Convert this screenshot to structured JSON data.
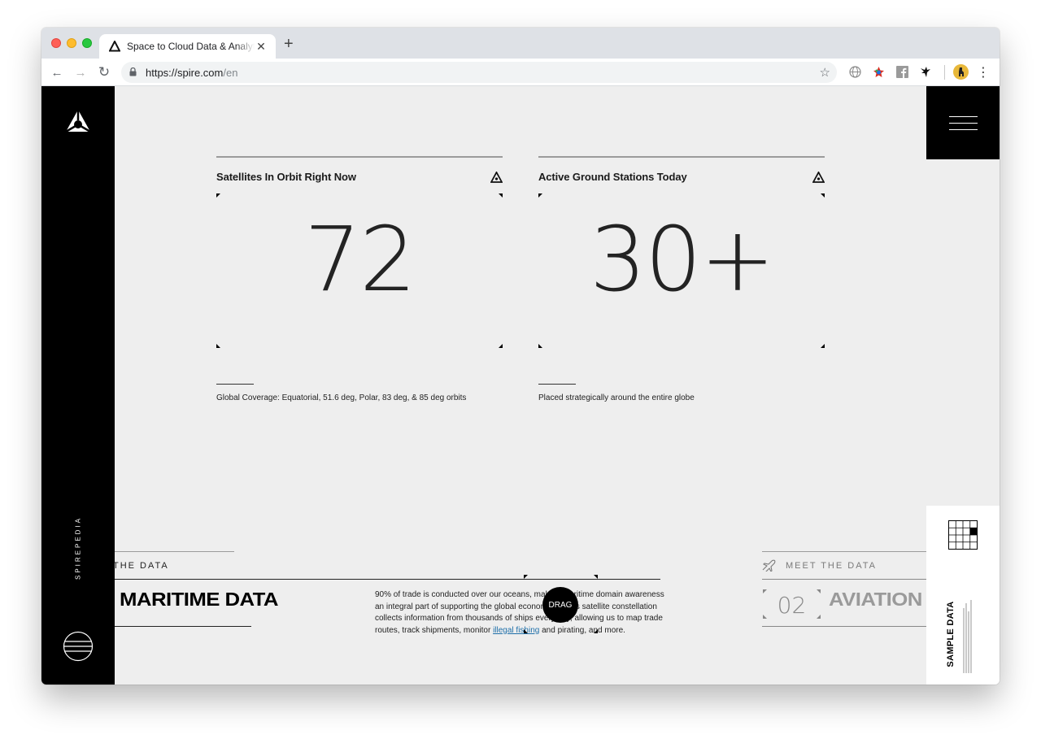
{
  "browser": {
    "tab_title": "Space to Cloud Data & Analytics",
    "tab_close": "✕",
    "new_tab": "+",
    "url_host": "https://spire.com",
    "url_path": "/en",
    "back": "←",
    "forward": "→",
    "reload": "↻",
    "star": "☆",
    "menu": "⋮"
  },
  "sidebar": {
    "label": "SPIREPEDIA"
  },
  "stats": [
    {
      "label": "Satellites In Orbit Right Now",
      "value": "72",
      "caption": "Global Coverage: Equatorial, 51.6 deg, Polar, 83 deg, & 85 deg orbits"
    },
    {
      "label": "Active Ground Stations Today",
      "value": "30+",
      "caption": "Placed strategically around the entire globe"
    }
  ],
  "carousel": {
    "current_label": "THE DATA",
    "current_title": "MARITIME DATA",
    "description_before": "90% of trade is conducted over our oceans, making maritime domain awareness an integral part of supporting the global economy. Spire's satellite constellation collects information from thousands of ships every day, allowing us to map trade routes, track shipments, monitor ",
    "description_link": "illegal fishing",
    "description_after": " and pirating, and more.",
    "drag_label": "DRAG",
    "next_label": "MEET THE DATA",
    "next_number": "02",
    "next_title": "AVIATION"
  },
  "sample_panel": {
    "title": "SAMPLE DATA"
  }
}
